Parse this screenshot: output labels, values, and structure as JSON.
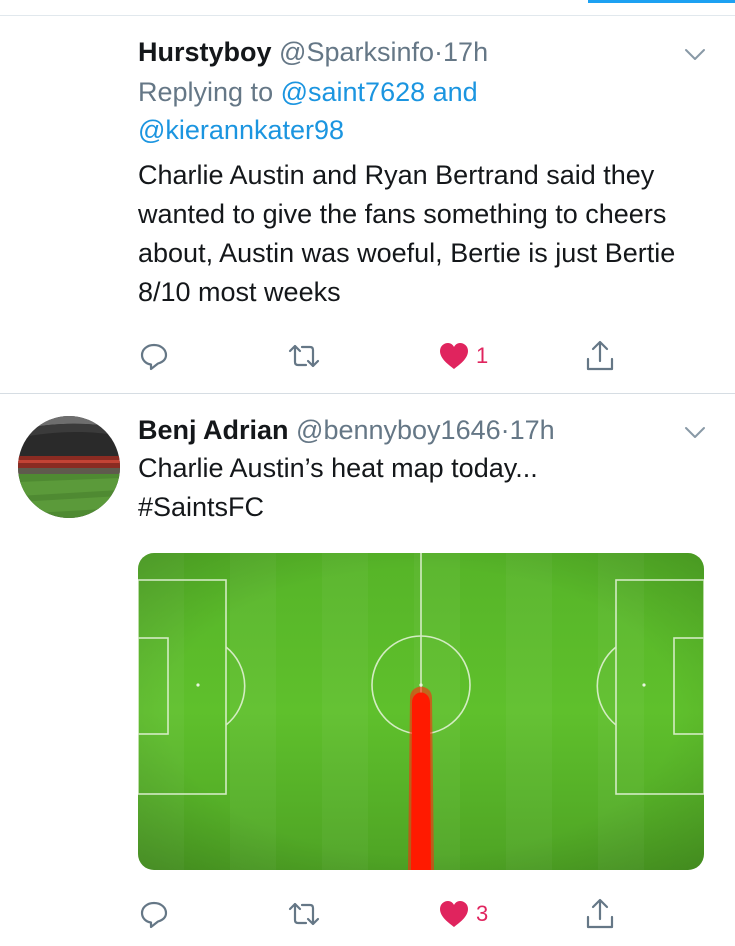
{
  "tweets": [
    {
      "display_name": "Hurstyboy",
      "handle": "@Sparksinfo",
      "separator": "·",
      "time": "17h",
      "reply_prefix": "Replying to",
      "reply_to_1": "@saint7628",
      "reply_and": "and",
      "reply_to_2": "@kierannkater98",
      "text": "Charlie Austin and Ryan Bertrand said they wanted to give the fans something to cheers about, Austin was woeful, Bertie is just Bertie 8/10 most weeks",
      "likes": "1"
    },
    {
      "display_name": "Benj Adrian",
      "handle": "@bennyboy1646",
      "separator": "·",
      "time": "17h",
      "text": "Charlie Austin’s heat map today...",
      "hashtag": "#SaintsFC",
      "likes": "3"
    }
  ],
  "icons": {
    "reply": "reply-icon",
    "retweet": "retweet-icon",
    "like": "heart-icon",
    "share": "share-icon",
    "menu": "chevron-down-icon"
  },
  "colors": {
    "link": "#1b95e0",
    "like_active": "#e0245e",
    "muted": "#657786",
    "pitch": "#55b526",
    "heat": "#ff1a00"
  }
}
